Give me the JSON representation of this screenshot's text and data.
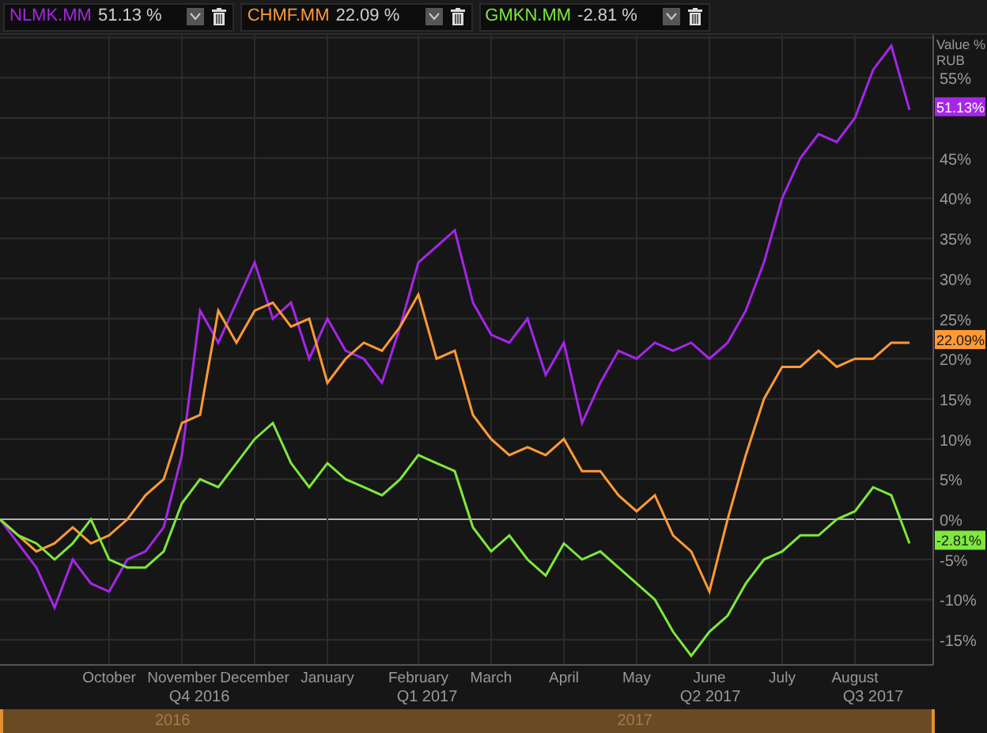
{
  "legend": [
    {
      "value": "51.13 %"
    },
    {
      "value": "22.09 %"
    },
    {
      "value": "-2.81 %"
    }
  ],
  "chart": {
    "axis_title": "Value %",
    "currency": "RUB",
    "last_labels": [
      "51.13%",
      "22.09%",
      "-2.81%"
    ],
    "quarters": [
      {
        "label": "Q4 2016"
      },
      {
        "label": "Q1 2017"
      },
      {
        "label": "Q2 2017"
      },
      {
        "label": "Q3 2017"
      }
    ],
    "chart_data": {
      "type": "line",
      "grid": true,
      "categories": [
        null,
        null,
        null,
        null,
        null,
        null,
        "October",
        null,
        null,
        null,
        "November",
        null,
        null,
        null,
        "December",
        null,
        null,
        null,
        "January",
        null,
        null,
        null,
        null,
        "February",
        null,
        null,
        null,
        "March",
        null,
        null,
        null,
        "April",
        null,
        null,
        null,
        "May",
        null,
        null,
        null,
        "June",
        null,
        null,
        null,
        "July",
        null,
        null,
        null,
        "August",
        null,
        null,
        null
      ],
      "series": [
        {
          "name": "NLMK.MM",
          "color": "#a526e8",
          "values": [
            0,
            -3,
            -6,
            -11,
            -5,
            -8,
            -9,
            -5,
            -4,
            -1,
            8,
            26,
            22,
            27,
            32,
            25,
            27,
            20,
            25,
            21,
            20,
            17,
            24,
            32,
            34,
            36,
            27,
            23,
            22,
            25,
            18,
            22,
            12,
            17,
            21,
            20,
            22,
            21,
            22,
            20,
            22,
            26,
            32,
            40,
            45,
            48,
            47,
            50,
            56,
            59,
            51
          ]
        },
        {
          "name": "CHMF.MM",
          "color": "#ff9a36",
          "values": [
            0,
            -2,
            -4,
            -3,
            -1,
            -3,
            -2,
            0,
            3,
            5,
            12,
            13,
            26,
            22,
            26,
            27,
            24,
            25,
            17,
            20,
            22,
            21,
            24,
            28,
            20,
            21,
            13,
            10,
            8,
            9,
            8,
            10,
            6,
            6,
            3,
            1,
            3,
            -2,
            -4,
            -9,
            0,
            8,
            15,
            19,
            19,
            21,
            19,
            20,
            20,
            22,
            22
          ]
        },
        {
          "name": "GMKN.MM",
          "color": "#7ee83c",
          "values": [
            0,
            -2,
            -3,
            -5,
            -3,
            0,
            -5,
            -6,
            -6,
            -4,
            2,
            5,
            4,
            7,
            10,
            12,
            7,
            4,
            7,
            5,
            4,
            3,
            5,
            8,
            7,
            6,
            -1,
            -4,
            -2,
            -5,
            -7,
            -3,
            -5,
            -4,
            -6,
            -8,
            -10,
            -14,
            -17,
            -14,
            -12,
            -8,
            -5,
            -4,
            -2,
            -2,
            0,
            1,
            4,
            3,
            -3
          ]
        }
      ],
      "ylim": [
        -18,
        60
      ],
      "yticks": [
        {
          "value": -15,
          "label": "-15%"
        },
        {
          "value": -10,
          "label": "-10%"
        },
        {
          "value": -5,
          "label": "-5%"
        },
        {
          "value": 0,
          "label": "0%"
        },
        {
          "value": 5,
          "label": "5%"
        },
        {
          "value": 10,
          "label": "10%"
        },
        {
          "value": 15,
          "label": "15%"
        },
        {
          "value": 20,
          "label": "20%"
        },
        {
          "value": 25,
          "label": "25%"
        },
        {
          "value": 30,
          "label": "30%"
        },
        {
          "value": 35,
          "label": "35%"
        },
        {
          "value": 40,
          "label": "40%"
        },
        {
          "value": 45,
          "label": "45%"
        },
        {
          "value": 55,
          "label": "55%"
        }
      ]
    }
  },
  "navigator": {
    "years": [
      {
        "label": "2016"
      },
      {
        "label": "2017"
      }
    ]
  }
}
